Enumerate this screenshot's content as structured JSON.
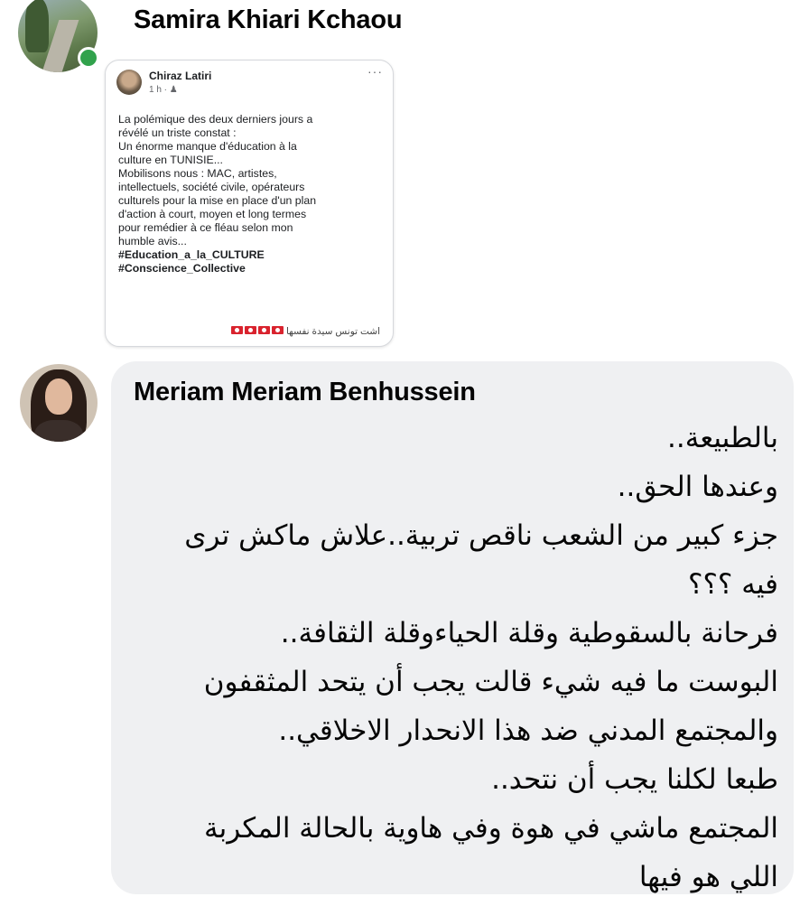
{
  "comments": [
    {
      "author": "Samira Khiari Kchaou",
      "online": true,
      "attachment": {
        "author": "Chiraz Latiri",
        "meta": "1 h · ",
        "audience_icon": "friends-icon",
        "more_label": "···",
        "body_lines": [
          "La polémique des deux derniers jours a",
          "révélé un triste constat  :",
          "Un énorme manque  d'éducation à la",
          "culture  en TUNISIE...",
          "Mobilisons nous : MAC, artistes,",
          "intellectuels, société civile, opérateurs",
          "culturels pour la mise en place d'un plan",
          "d'action à court, moyen et long termes",
          "pour remédier à ce fléau selon mon",
          "humble avis..."
        ],
        "hashtags": [
          "#Education_a_la_CULTURE",
          "#Conscience_Collective"
        ],
        "footer_text": "اشت تونس سيدة نفسها",
        "footer_flags": "tunisia-flag-icons"
      }
    },
    {
      "author": "Meriam Meriam Benhussein",
      "text_lines": [
        "بالطبيعة..",
        "وعندها الحق..",
        "جزء كبير من الشعب ناقص تربية..علاش ماكش ترى",
        "فيه ؟؟؟",
        "فرحانة بالسقوطية وقلة الحياءوقلة الثقافة..",
        "البوست ما فيه شيء قالت يجب أن يتحد المثقفون",
        "والمجتمع المدني ضد هذا الانحدار الاخلاقي..",
        "طبعا لكلنا يجب أن نتحد..",
        "المجتمع ماشي في هوة وفي هاوية بالحالة المكربة",
        "اللي هو فيها"
      ]
    }
  ],
  "colors": {
    "online": "#31a24c",
    "bubble": "#eff0f2",
    "flag": "#d9232e"
  }
}
